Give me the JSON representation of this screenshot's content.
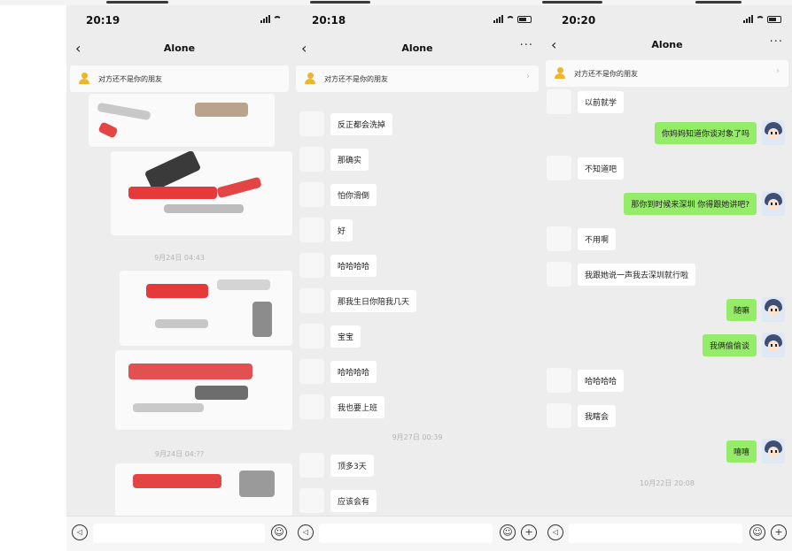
{
  "chat_title": "Alone",
  "banner_text": "对方还不是你的朋友",
  "phones": [
    {
      "time": "20:19",
      "timestamps": [
        "9月24日 04:43",
        "9月24日 04:??"
      ],
      "messages": []
    },
    {
      "time": "20:18",
      "timestamps": [
        "9月27日 00:39"
      ],
      "messages": [
        {
          "side": "in",
          "text": "反正都会洗掉"
        },
        {
          "side": "in",
          "text": "那确实"
        },
        {
          "side": "in",
          "text": "怕你滑倒"
        },
        {
          "side": "in",
          "text": "好"
        },
        {
          "side": "in",
          "text": "哈哈哈哈"
        },
        {
          "side": "in",
          "text": "那我生日你陪我几天"
        },
        {
          "side": "in",
          "text": "宝宝"
        },
        {
          "side": "in",
          "text": "哈哈哈哈"
        },
        {
          "side": "in",
          "text": "我也要上班"
        },
        {
          "side": "in",
          "text": "顶多3天"
        },
        {
          "side": "in",
          "text": "应该会有"
        }
      ]
    },
    {
      "time": "20:20",
      "timestamps": [
        "10月22日 20:08"
      ],
      "messages": [
        {
          "side": "in",
          "text": "以前就学"
        },
        {
          "side": "out",
          "text": "你妈妈知道你谈对象了吗"
        },
        {
          "side": "in",
          "text": "不知道吧"
        },
        {
          "side": "out",
          "text": "那你到时候来深圳 你得跟她讲吧?"
        },
        {
          "side": "in",
          "text": "不用啊"
        },
        {
          "side": "in",
          "text": "我跟她说一声我去深圳就行啦"
        },
        {
          "side": "out",
          "text": "随嘛"
        },
        {
          "side": "out",
          "text": "我俩偷偷谈"
        },
        {
          "side": "in",
          "text": "哈哈哈哈"
        },
        {
          "side": "in",
          "text": "我瞎会"
        },
        {
          "side": "out",
          "text": "嘻嘻"
        }
      ]
    }
  ],
  "icons": {
    "back": "chevron-left-icon",
    "more": "ellipsis-icon",
    "banner": "user-add-icon",
    "voice": "voice-icon",
    "emoji": "emoji-icon",
    "plus": "plus-icon"
  },
  "colors": {
    "background": "#ededed",
    "outgoing_bubble": "#95ec69",
    "incoming_bubble": "#ffffff",
    "banner_icon": "#f0b429"
  }
}
